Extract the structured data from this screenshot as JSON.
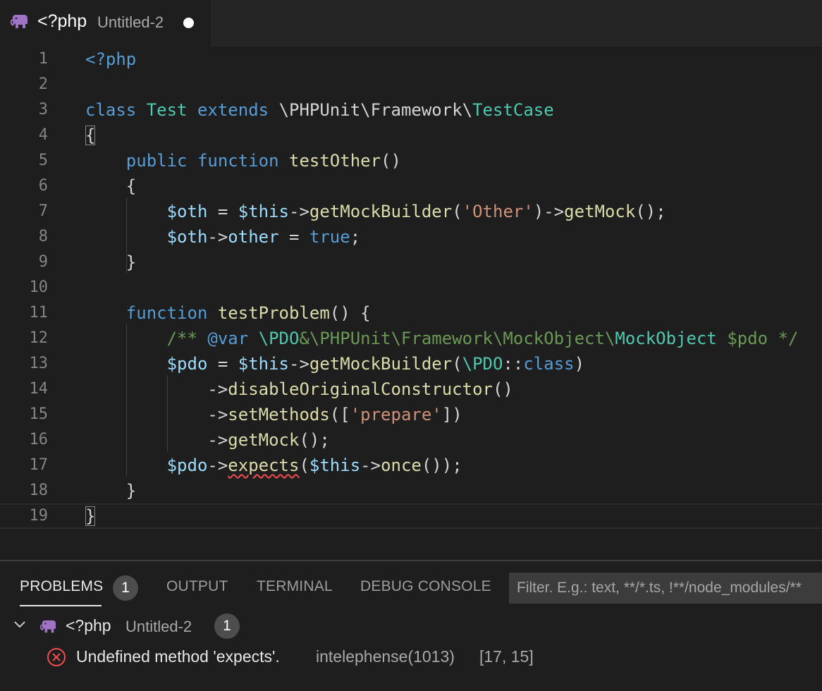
{
  "tab": {
    "language": "<?php",
    "filename": "Untitled-2",
    "icon": "php-elephant-icon"
  },
  "editor": {
    "lines": [
      {
        "n": "1"
      },
      {
        "n": "2"
      },
      {
        "n": "3"
      },
      {
        "n": "4"
      },
      {
        "n": "5"
      },
      {
        "n": "6"
      },
      {
        "n": "7"
      },
      {
        "n": "8"
      },
      {
        "n": "9"
      },
      {
        "n": "10"
      },
      {
        "n": "11"
      },
      {
        "n": "12"
      },
      {
        "n": "13"
      },
      {
        "n": "14"
      },
      {
        "n": "15"
      },
      {
        "n": "16"
      },
      {
        "n": "17"
      },
      {
        "n": "18"
      },
      {
        "n": "19"
      }
    ],
    "code": {
      "l1_open": "<?php",
      "l3_class": "class",
      "l3_name": "Test",
      "l3_extends": "extends",
      "l3_ns": "\\PHPUnit\\Framework\\",
      "l3_parent": "TestCase",
      "l4_brace": "{",
      "l5_public": "public",
      "l5_function": "function",
      "l5_name": "testOther",
      "l5_parens": "()",
      "l6_brace": "{",
      "l7_var": "$oth",
      "l7_eq": " = ",
      "l7_this": "$this",
      "l7_arrow1": "->",
      "l7_m1": "getMockBuilder",
      "l7_p1": "(",
      "l7_str": "'Other'",
      "l7_p2": ")->",
      "l7_m2": "getMock",
      "l7_end": "();",
      "l8_var": "$oth",
      "l8_arrow": "->",
      "l8_prop": "other",
      "l8_eq": " = ",
      "l8_true": "true",
      "l8_end": ";",
      "l9_brace": "}",
      "l11_function": "function",
      "l11_name": "testProblem",
      "l11_rest": "() {",
      "l12_comment_start": "/** ",
      "l12_tag": "@var",
      "l12_sp": " ",
      "l12_pdo": "\\PDO",
      "l12_amp": "&",
      "l12_ns": "\\PHPUnit\\Framework\\MockObject\\",
      "l12_mock": "MockObject",
      "l12_tail": " $pdo */",
      "l13_var": "$pdo",
      "l13_eq": " = ",
      "l13_this": "$this",
      "l13_arrow": "->",
      "l13_m": "getMockBuilder",
      "l13_p": "(",
      "l13_pdo": "\\PDO",
      "l13_cc": "::",
      "l13_class": "class",
      "l13_end": ")",
      "l14_arrow": "->",
      "l14_m": "disableOriginalConstructor",
      "l14_end": "()",
      "l15_arrow": "->",
      "l15_m": "setMethods",
      "l15_p": "([",
      "l15_str": "'prepare'",
      "l15_end": "])",
      "l16_arrow": "->",
      "l16_m": "getMock",
      "l16_end": "();",
      "l17_var": "$pdo",
      "l17_arrow": "->",
      "l17_m": "expects",
      "l17_p": "(",
      "l17_this": "$this",
      "l17_arrow2": "->",
      "l17_m2": "once",
      "l17_end": "());",
      "l18_brace": "}",
      "l19_brace": "}"
    }
  },
  "panel": {
    "tabs": [
      {
        "label": "PROBLEMS",
        "badge": "1"
      },
      {
        "label": "OUTPUT"
      },
      {
        "label": "TERMINAL"
      },
      {
        "label": "DEBUG CONSOLE"
      }
    ],
    "filter_placeholder": "Filter. E.g.: text, **/*.ts, !**/node_modules/**",
    "group": {
      "language": "<?php",
      "filename": "Untitled-2",
      "count": "1"
    },
    "problem": {
      "message": "Undefined method 'expects'.",
      "source": "intelephense(1013)",
      "position": "[17, 15]"
    }
  },
  "colors": {
    "keyword": "#569cd6",
    "class": "#4ec9b0",
    "function": "#dcdcaa",
    "variable": "#9cdcfe",
    "string": "#ce9178",
    "comment": "#6a9955",
    "error": "#f14c4c",
    "php_icon": "#a074c4"
  }
}
